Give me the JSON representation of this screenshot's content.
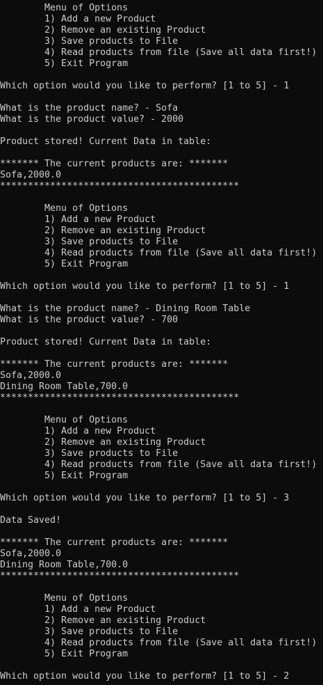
{
  "console": {
    "lines": [
      "        Menu of Options",
      "        1) Add a new Product",
      "        2) Remove an existing Product",
      "        3) Save products to File",
      "        4) Read products from file (Save all data first!)",
      "        5) Exit Program",
      "",
      "Which option would you like to perform? [1 to 5] - 1",
      "",
      "What is the product name? - Sofa",
      "What is the product value? - 2000",
      "",
      "Product stored! Current Data in table:",
      "",
      "******* The current products are: *******",
      "Sofa,2000.0",
      "*******************************************",
      "",
      "        Menu of Options",
      "        1) Add a new Product",
      "        2) Remove an existing Product",
      "        3) Save products to File",
      "        4) Read products from file (Save all data first!)",
      "        5) Exit Program",
      "",
      "Which option would you like to perform? [1 to 5] - 1",
      "",
      "What is the product name? - Dining Room Table",
      "What is the product value? - 700",
      "",
      "Product stored! Current Data in table:",
      "",
      "******* The current products are: *******",
      "Sofa,2000.0",
      "Dining Room Table,700.0",
      "*******************************************",
      "",
      "        Menu of Options",
      "        1) Add a new Product",
      "        2) Remove an existing Product",
      "        3) Save products to File",
      "        4) Read products from file (Save all data first!)",
      "        5) Exit Program",
      "",
      "Which option would you like to perform? [1 to 5] - 3",
      "",
      "Data Saved!",
      "",
      "******* The current products are: *******",
      "Sofa,2000.0",
      "Dining Room Table,700.0",
      "*******************************************",
      "",
      "        Menu of Options",
      "        1) Add a new Product",
      "        2) Remove an existing Product",
      "        3) Save products to File",
      "        4) Read products from file (Save all data first!)",
      "        5) Exit Program",
      "",
      "Which option would you like to perform? [1 to 5] - 2"
    ]
  },
  "colors": {
    "background": "#0c0c0c",
    "text": "#cccccc"
  }
}
